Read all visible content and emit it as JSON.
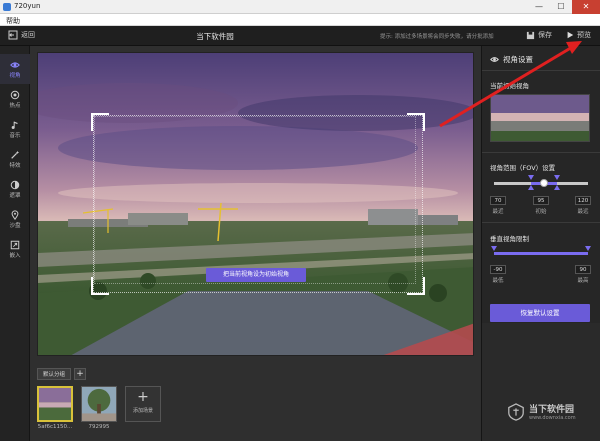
{
  "window": {
    "title": "720yun",
    "controls": [
      "—",
      "☐",
      "✕"
    ]
  },
  "menu": {
    "help": "帮助"
  },
  "header": {
    "back_label": "返回",
    "title": "当下软件园",
    "hint": "提示: 添加过多场景将会同步失败，请分批添加",
    "save_label": "保存",
    "preview_label": "预览"
  },
  "sidebar": {
    "items": [
      {
        "label": "视角",
        "icon": "eye-icon",
        "active": true
      },
      {
        "label": "热点",
        "icon": "hotspot-icon",
        "active": false
      },
      {
        "label": "音乐",
        "icon": "music-icon",
        "active": false
      },
      {
        "label": "特效",
        "icon": "magic-wand-icon",
        "active": false
      },
      {
        "label": "遮罩",
        "icon": "mask-icon",
        "active": false
      },
      {
        "label": "沙盘",
        "icon": "location-pin-icon",
        "active": false
      },
      {
        "label": "嵌入",
        "icon": "embed-icon",
        "active": false
      }
    ]
  },
  "viewport": {
    "set_initial_label": "把当前视角设为初始视角"
  },
  "scenes": {
    "group_tab": "默认分组",
    "add_group": "+",
    "items": [
      {
        "caption": "5af6c1150...",
        "selected": true
      },
      {
        "caption": "792995",
        "selected": false
      }
    ],
    "add_scene_label": "添加场景",
    "add_scene_plus": "+"
  },
  "panel": {
    "title": "视角设置",
    "initial_view_label": "当前初始视角",
    "fov_label": "视角范围（FOV）设置",
    "fov": {
      "min": "70",
      "init": "95",
      "max": "120",
      "min_label": "最近",
      "init_label": "初始",
      "max_label": "最远",
      "range_min": 0,
      "range_max": 180,
      "value_min": 70,
      "value_init": 95,
      "value_max": 120
    },
    "vertical_label": "垂直视角限制",
    "vertical": {
      "min": "-90",
      "max": "90",
      "min_label": "最低",
      "max_label": "最高",
      "range_min": -90,
      "range_max": 90,
      "value_min": -90,
      "value_max": 90
    },
    "reset_label": "恢复默认设置"
  },
  "watermark": {
    "text": "当下软件园",
    "sub": "www.downxia.com"
  },
  "colors": {
    "accent": "#6a5bd8",
    "annotation_arrow": "#e02020",
    "thumb_selected": "#d9c23a"
  }
}
